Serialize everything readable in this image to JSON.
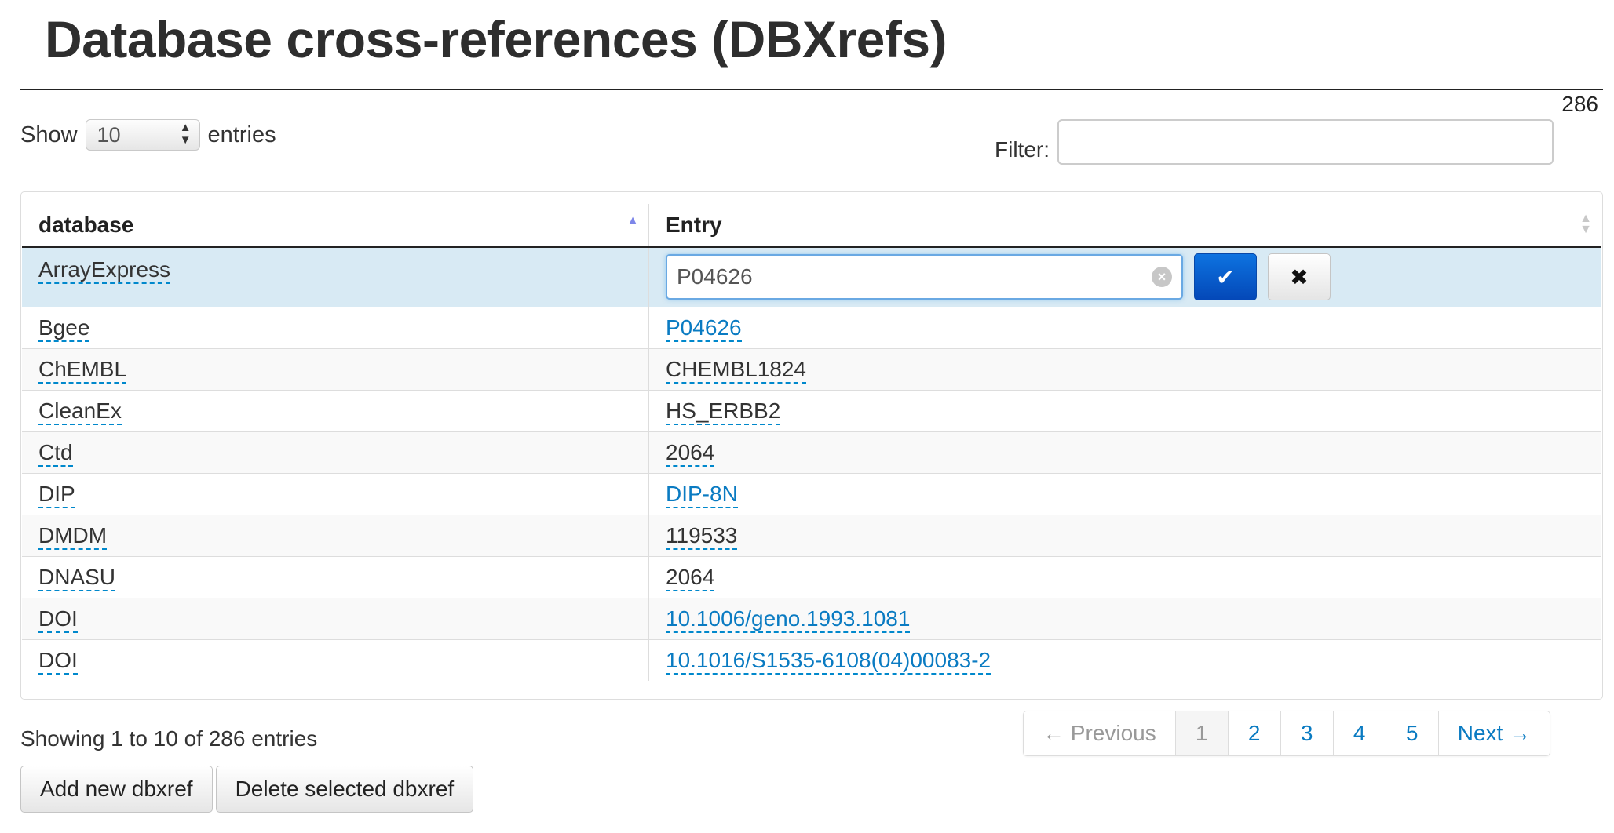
{
  "page": {
    "title": "Database cross-references (DBXrefs)",
    "total_count": "286"
  },
  "length": {
    "label_before": "Show",
    "value": "10",
    "label_after": "entries"
  },
  "filter": {
    "label": "Filter:",
    "value": "",
    "placeholder": ""
  },
  "table": {
    "columns": [
      {
        "label": "database",
        "sort": "ascending"
      },
      {
        "label": "Entry",
        "sort": "none"
      }
    ],
    "editing": {
      "database": "ArrayExpress",
      "input_value": "P04626"
    },
    "rows": [
      {
        "database": "Bgee",
        "entry": "P04626",
        "entry_is_link": true
      },
      {
        "database": "ChEMBL",
        "entry": "CHEMBL1824",
        "entry_is_link": false
      },
      {
        "database": "CleanEx",
        "entry": "HS_ERBB2",
        "entry_is_link": false
      },
      {
        "database": "Ctd",
        "entry": "2064",
        "entry_is_link": false
      },
      {
        "database": "DIP",
        "entry": "DIP-8N",
        "entry_is_link": true
      },
      {
        "database": "DMDM",
        "entry": "119533",
        "entry_is_link": false
      },
      {
        "database": "DNASU",
        "entry": "2064",
        "entry_is_link": false
      },
      {
        "database": "DOI",
        "entry": "10.1006/geno.1993.1081",
        "entry_is_link": true
      },
      {
        "database": "DOI",
        "entry": "10.1016/S1535-6108(04)00083-2",
        "entry_is_link": true
      }
    ]
  },
  "info": "Showing 1 to 10 of 286 entries",
  "pagination": {
    "previous": "← Previous",
    "pages": [
      "1",
      "2",
      "3",
      "4",
      "5"
    ],
    "active_page": "1",
    "next": "Next →"
  },
  "actions": {
    "add": "Add new dbxref",
    "delete": "Delete selected dbxref"
  },
  "colors": {
    "link": "#0a7bc2",
    "selected_row": "#d8eaf4",
    "primary_button": "#0a5fd0",
    "sort_active": "#7d86e9"
  }
}
